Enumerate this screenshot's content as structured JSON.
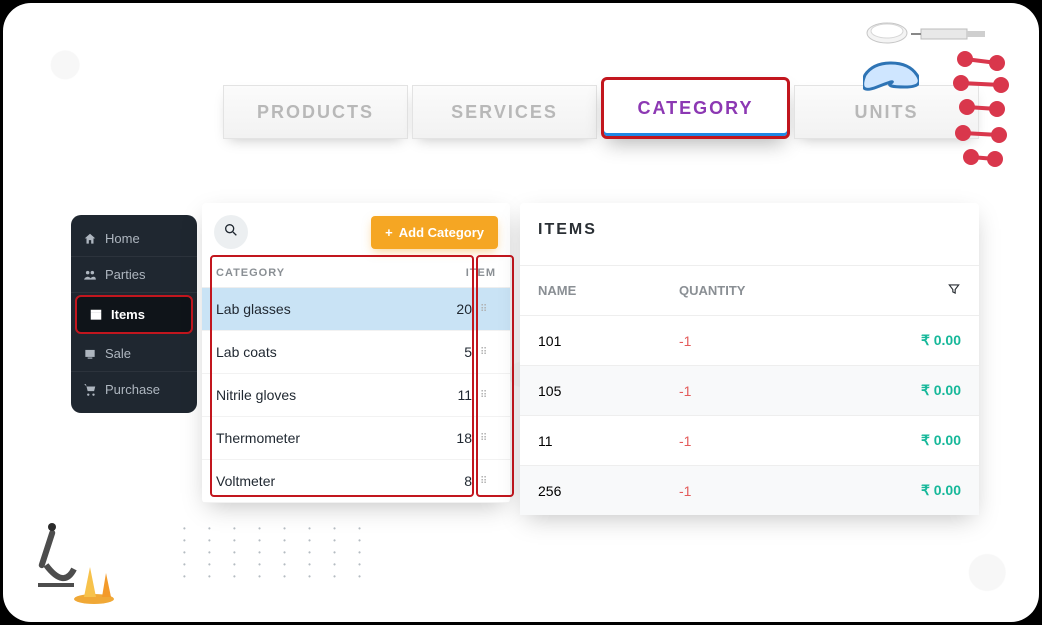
{
  "tabs": [
    {
      "label": "PRODUCTS",
      "active": false
    },
    {
      "label": "SERVICES",
      "active": false
    },
    {
      "label": "CATEGORY",
      "active": true
    },
    {
      "label": "UNITS",
      "active": false
    }
  ],
  "sidebar": {
    "home": "Home",
    "parties": "Parties",
    "items": "Items",
    "sale": "Sale",
    "purchase": "Purchase"
  },
  "categoryPanel": {
    "addLabel": "Add Category",
    "head": {
      "category": "CATEGORY",
      "item": "ITEM"
    },
    "rows": [
      {
        "name": "Lab glasses",
        "count": "20",
        "selected": true
      },
      {
        "name": "Lab coats",
        "count": "5",
        "selected": false
      },
      {
        "name": "Nitrile gloves",
        "count": "11",
        "selected": false
      },
      {
        "name": "Thermometer",
        "count": "18",
        "selected": false
      },
      {
        "name": "Voltmeter",
        "count": "8",
        "selected": false
      }
    ]
  },
  "itemsPanel": {
    "title": "ITEMS",
    "head": {
      "name": "NAME",
      "qty": "QUANTITY"
    },
    "rows": [
      {
        "name": "101",
        "qty": "-1",
        "amount": "₹ 0.00"
      },
      {
        "name": "105",
        "qty": "-1",
        "amount": "₹ 0.00"
      },
      {
        "name": "11",
        "qty": "-1",
        "amount": "₹ 0.00"
      },
      {
        "name": "256",
        "qty": "-1",
        "amount": "₹ 0.00"
      }
    ]
  }
}
